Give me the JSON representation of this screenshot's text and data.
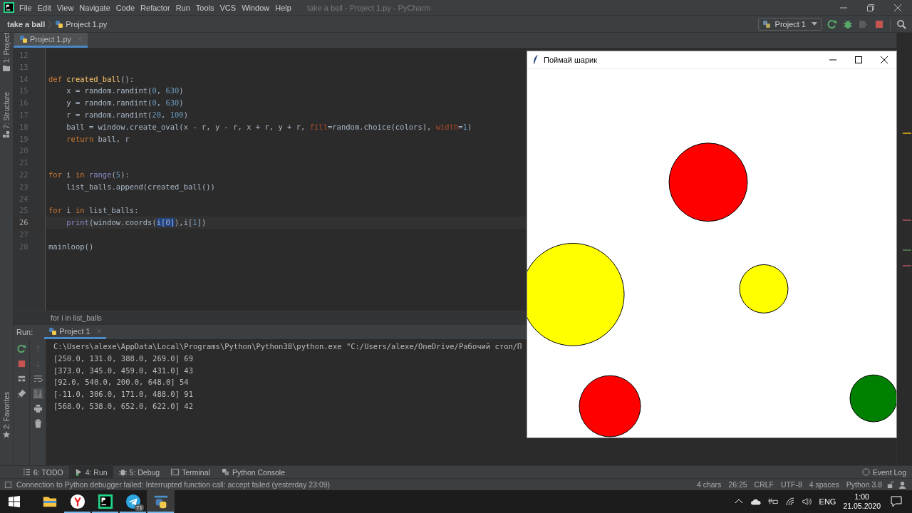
{
  "ide_window": {
    "title": "take a ball - Project 1.py - PyCharm"
  },
  "menu": [
    "File",
    "Edit",
    "View",
    "Navigate",
    "Code",
    "Refactor",
    "Run",
    "Tools",
    "VCS",
    "Window",
    "Help"
  ],
  "breadcrumb": [
    {
      "kind": "project",
      "label": "take a ball"
    },
    {
      "kind": "file",
      "label": "Project 1.py"
    }
  ],
  "run_configuration": "Project 1",
  "side_tools": [
    {
      "label": "1: Project"
    },
    {
      "label": "7: Structure"
    },
    {
      "label": "2: Favorites"
    }
  ],
  "editor_tabs": [
    {
      "label": "Project 1.py",
      "selected": true
    }
  ],
  "code_lines": [
    {
      "number": "12",
      "current": false
    },
    {
      "number": "13",
      "current": false
    },
    {
      "number": "14",
      "current": false,
      "tokens": [
        {
          "kind": "kw",
          "text": "def "
        },
        {
          "kind": "fn",
          "text": "created_ball"
        },
        {
          "kind": "plain",
          "text": "():"
        }
      ]
    },
    {
      "number": "15",
      "current": false,
      "tokens": [
        {
          "kind": "plain",
          "text": "    x = random.randint("
        },
        {
          "kind": "num",
          "text": "0"
        },
        {
          "kind": "plain",
          "text": ", "
        },
        {
          "kind": "num",
          "text": "630"
        },
        {
          "kind": "plain",
          "text": ")"
        }
      ]
    },
    {
      "number": "16",
      "current": false,
      "tokens": [
        {
          "kind": "plain",
          "text": "    y = random.randint("
        },
        {
          "kind": "num",
          "text": "0"
        },
        {
          "kind": "plain",
          "text": ", "
        },
        {
          "kind": "num",
          "text": "630"
        },
        {
          "kind": "plain",
          "text": ")"
        }
      ]
    },
    {
      "number": "17",
      "current": false,
      "tokens": [
        {
          "kind": "plain",
          "text": "    r = random.randint("
        },
        {
          "kind": "num",
          "text": "20"
        },
        {
          "kind": "plain",
          "text": ", "
        },
        {
          "kind": "num",
          "text": "100"
        },
        {
          "kind": "plain",
          "text": ")"
        }
      ]
    },
    {
      "number": "18",
      "current": false,
      "tokens": [
        {
          "kind": "plain",
          "text": "    ball = window.create_oval(x - r, y - r, x + r, y + r, "
        },
        {
          "kind": "param",
          "text": "fill"
        },
        {
          "kind": "plain",
          "text": "=random.choice(colors), "
        },
        {
          "kind": "param",
          "text": "width"
        },
        {
          "kind": "plain",
          "text": "="
        },
        {
          "kind": "num",
          "text": "1"
        },
        {
          "kind": "plain",
          "text": ")"
        }
      ]
    },
    {
      "number": "19",
      "current": false,
      "tokens": [
        {
          "kind": "kw",
          "text": "    return"
        },
        {
          "kind": "plain",
          "text": " ball, r"
        }
      ]
    },
    {
      "number": "20",
      "current": false
    },
    {
      "number": "21",
      "current": false
    },
    {
      "number": "22",
      "current": false,
      "tokens": [
        {
          "kind": "kw",
          "text": "for"
        },
        {
          "kind": "plain",
          "text": " i "
        },
        {
          "kind": "kw",
          "text": "in "
        },
        {
          "kind": "builtin",
          "text": "range"
        },
        {
          "kind": "plain",
          "text": "("
        },
        {
          "kind": "num",
          "text": "5"
        },
        {
          "kind": "plain",
          "text": "):"
        }
      ]
    },
    {
      "number": "23",
      "current": false,
      "tokens": [
        {
          "kind": "plain",
          "text": "    list_balls.append(created_ball())"
        }
      ]
    },
    {
      "number": "24",
      "current": false
    },
    {
      "number": "25",
      "current": false,
      "tokens": [
        {
          "kind": "kw",
          "text": "for"
        },
        {
          "kind": "plain",
          "text": " i "
        },
        {
          "kind": "kw",
          "text": "in"
        },
        {
          "kind": "plain",
          "text": " list_balls:"
        }
      ]
    },
    {
      "number": "26",
      "current": true,
      "tokens": [
        {
          "kind": "builtin",
          "text": "    print"
        },
        {
          "kind": "plain",
          "text": "(window.coords("
        },
        {
          "kind": "sel",
          "text": "i[0]"
        },
        {
          "kind": "plain",
          "text": "),i["
        },
        {
          "kind": "num",
          "text": "1"
        },
        {
          "kind": "plain",
          "text": "])"
        }
      ]
    },
    {
      "number": "27",
      "current": false
    },
    {
      "number": "28",
      "current": false,
      "tokens": [
        {
          "kind": "plain",
          "text": "mainloop()"
        }
      ]
    }
  ],
  "breadcrumb_footer": "for i in list_balls",
  "run_panel": {
    "label": "Run:",
    "tabs": [
      {
        "label": "Project 1",
        "selected": true
      }
    ],
    "output": [
      "C:\\Users\\alexe\\AppData\\Local\\Programs\\Python\\Python38\\python.exe \"C:/Users/alexe/OneDrive/Рабочий стол/П",
      "[250.0, 131.0, 388.0, 269.0] 69",
      "[373.0, 345.0, 459.0, 431.0] 43",
      "[92.0, 540.0, 200.0, 648.0] 54",
      "[-11.0, 306.0, 171.0, 488.0] 91",
      "[568.0, 538.0, 652.0, 622.0] 42"
    ]
  },
  "tool_windows": [
    {
      "kind": "todo",
      "label": "6: TODO",
      "selected": false
    },
    {
      "kind": "run",
      "label": "4: Run",
      "selected": true
    },
    {
      "kind": "debug",
      "label": "5: Debug",
      "selected": false
    },
    {
      "kind": "terminal",
      "label": "Terminal",
      "selected": false
    },
    {
      "kind": "console",
      "label": "Python Console",
      "selected": false
    }
  ],
  "event_log": "Event Log",
  "status_message": "Connection to Python debugger failed: Interrupted function call: accept failed (yesterday 23:09)",
  "status_items": [
    "4 chars",
    "26:25",
    "CRLF",
    "UTF-8",
    "4 spaces",
    "Python 3.8"
  ],
  "taskbar": {
    "apps": [
      {
        "kind": "files",
        "running": false,
        "selected": false
      },
      {
        "kind": "browser",
        "running": true,
        "selected": false
      },
      {
        "kind": "ide",
        "running": true,
        "selected": false
      },
      {
        "kind": "messenger",
        "running": true,
        "selected": false,
        "badge": "71"
      },
      {
        "kind": "python",
        "running": true,
        "selected": true
      }
    ],
    "language": "ENG",
    "time": "1:00",
    "date": "21.05.2020"
  },
  "app_window": {
    "title": "Поймай шарик",
    "balls": [
      {
        "color": "#ff0000"
      },
      {
        "color": "#ffff00"
      },
      {
        "color": "#ffff00"
      },
      {
        "color": "#ff0000"
      },
      {
        "color": "#008000"
      }
    ]
  }
}
